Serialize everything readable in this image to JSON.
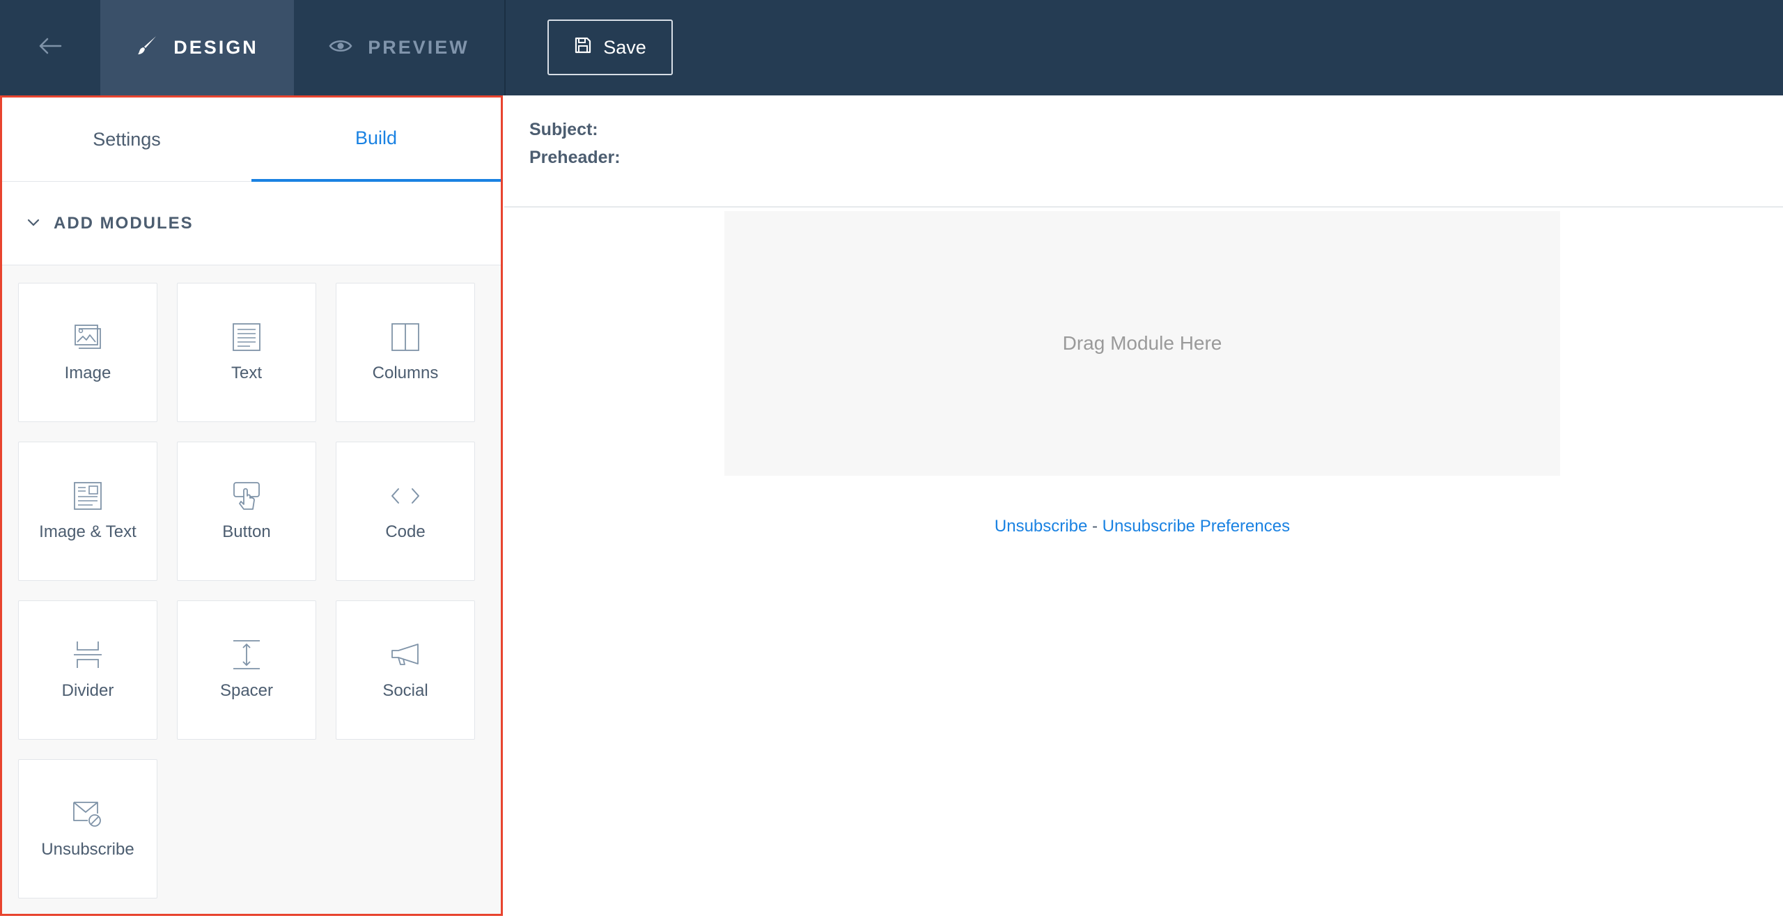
{
  "topbar": {
    "back_icon": "arrow-left-icon",
    "design_label": "DESIGN",
    "design_icon": "brush-icon",
    "preview_label": "PREVIEW",
    "preview_icon": "eye-icon",
    "save_label": "Save",
    "save_icon": "floppy-disk-icon"
  },
  "panel": {
    "tabs": [
      {
        "label": "Settings",
        "active": false
      },
      {
        "label": "Build",
        "active": true
      }
    ],
    "section_title": "ADD MODULES",
    "section_icon": "chevron-down-icon",
    "modules": [
      {
        "label": "Image",
        "icon": "image-icon"
      },
      {
        "label": "Text",
        "icon": "text-icon"
      },
      {
        "label": "Columns",
        "icon": "columns-icon"
      },
      {
        "label": "Image & Text",
        "icon": "image-text-icon"
      },
      {
        "label": "Button",
        "icon": "button-pointer-icon"
      },
      {
        "label": "Code",
        "icon": "code-icon"
      },
      {
        "label": "Divider",
        "icon": "divider-icon"
      },
      {
        "label": "Spacer",
        "icon": "spacer-icon"
      },
      {
        "label": "Social",
        "icon": "megaphone-icon"
      },
      {
        "label": "Unsubscribe",
        "icon": "unsubscribe-icon"
      }
    ]
  },
  "email": {
    "subject_label": "Subject:",
    "preheader_label": "Preheader:",
    "drop_zone_text": "Drag Module Here",
    "unsubscribe_link": "Unsubscribe",
    "separator": " - ",
    "unsubscribe_preferences_link": "Unsubscribe Preferences"
  },
  "colors": {
    "topbar_bg": "#253c53",
    "active_tab_bg": "#3a5069",
    "accent": "#1a82e2",
    "highlight_border": "#e8442f",
    "text": "#4c5d70"
  }
}
